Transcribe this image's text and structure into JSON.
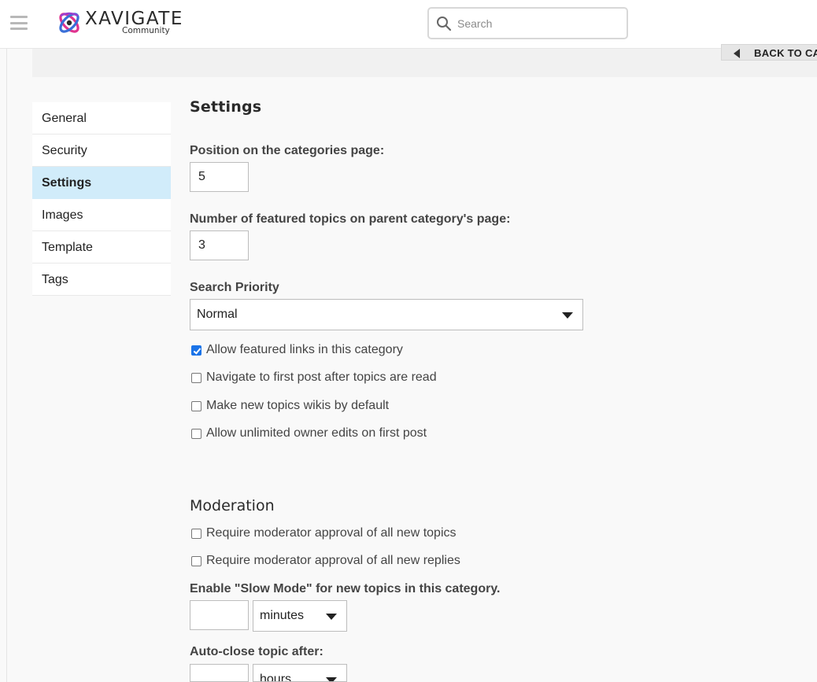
{
  "header": {
    "brand_name": "XAVIGATE",
    "brand_sub": "Community",
    "search_placeholder": "Search"
  },
  "back_button_label": "BACK TO CATEGORY",
  "nav": {
    "items": [
      {
        "label": "General"
      },
      {
        "label": "Security"
      },
      {
        "label": "Settings"
      },
      {
        "label": "Images"
      },
      {
        "label": "Template"
      },
      {
        "label": "Tags"
      }
    ],
    "active": "Settings"
  },
  "settings": {
    "title": "Settings",
    "position_label": "Position on the categories page:",
    "position_value": "5",
    "featured_label": "Number of featured topics on parent category's page:",
    "featured_value": "3",
    "search_priority_label": "Search Priority",
    "search_priority_value": "Normal",
    "checkboxes": [
      {
        "label": "Allow featured links in this category",
        "checked": true
      },
      {
        "label": "Navigate to first post after topics are read",
        "checked": false
      },
      {
        "label": "Make new topics wikis by default",
        "checked": false
      },
      {
        "label": "Allow unlimited owner edits on first post",
        "checked": false
      }
    ]
  },
  "moderation": {
    "title": "Moderation",
    "checkboxes": [
      {
        "label": "Require moderator approval of all new topics",
        "checked": false
      },
      {
        "label": "Require moderator approval of all new replies",
        "checked": false
      }
    ],
    "slow_mode_label": "Enable \"Slow Mode\" for new topics in this category.",
    "slow_mode_value": "",
    "slow_mode_unit": "minutes",
    "auto_close_label": "Auto-close topic after:",
    "auto_close_value": "",
    "auto_close_unit": "hours"
  },
  "colors": {
    "accent": "#1a73e8",
    "active_nav_bg": "#d1ecfa"
  }
}
